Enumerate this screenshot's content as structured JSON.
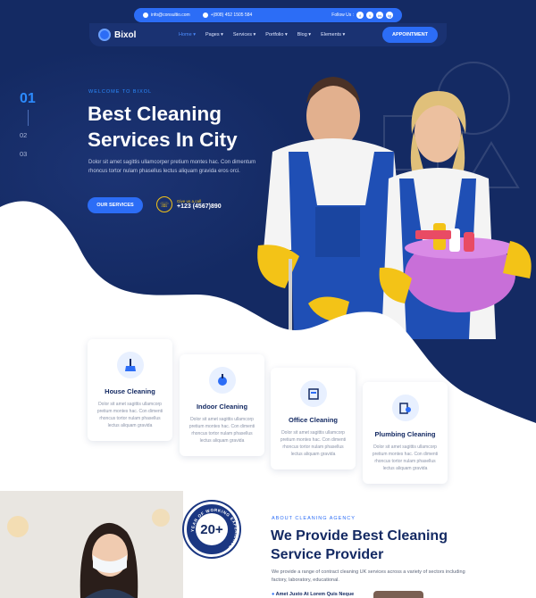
{
  "topbar": {
    "email": "info@consultio.com",
    "phone": "+(808) 452 1505 584",
    "follow_label": "Follow Us :",
    "social": [
      "f",
      "t",
      "in",
      "ig"
    ]
  },
  "nav": {
    "logo": "Bixol",
    "items": [
      "Home",
      "Pages",
      "Services",
      "Portfolio",
      "Blog",
      "Elements"
    ],
    "cta": "APPOINTMENT"
  },
  "hero": {
    "slides": [
      "01",
      "02",
      "03"
    ],
    "eyebrow": "WELCOME TO BIXOL",
    "title_line1": "Best Cleaning",
    "title_line2": "Services In City",
    "lead": "Dolor sit amet sagittis ullamcorper pretium montes hac. Con dimentum rhoncus tortor nulam phasellus lectus aliquam gravida eros orci.",
    "button": "OUR SERVICES",
    "call_label": "Give us a call",
    "call_number": "+123 (4567)890"
  },
  "services": [
    {
      "title": "House Cleaning",
      "desc": "Dolor sit amet sagittis ullamcorp pretium montes hac. Con dimenti rhoncus tortor nulam phasellus lectus aliquam gravida",
      "icon": "broom-icon"
    },
    {
      "title": "Indoor Cleaning",
      "desc": "Dolor sit amet sagittis ullamcorp pretium montes hac. Con dimenti rhoncus tortor nulam phasellus lectus aliquam gravida",
      "icon": "vacuum-icon"
    },
    {
      "title": "Office Cleaning",
      "desc": "Dolor sit amet sagittis ullamcorp pretium montes hac. Con dimenti rhoncus tortor nulam phasellus lectus aliquam gravida",
      "icon": "office-icon"
    },
    {
      "title": "Plumbing Cleaning",
      "desc": "Dolor sit amet sagittis ullamcorp pretium montes hac. Con dimenti rhoncus tortor nulam phasellus lectus aliquam gravida",
      "icon": "plumbing-icon"
    }
  ],
  "about": {
    "badge_ring": "YEAR OF WORKING EXPERIENCE",
    "badge_number": "20+",
    "eyebrow": "ABOUT CLEANING AGENCY",
    "title_line1": "We Provide Best Cleaning",
    "title_line2": "Service Provider",
    "text": "We provide a range of contract cleaning UK services across a variety of sectors including factory, laboratory, educational.",
    "item": "Amet Justo At Lorem Quis Neque"
  },
  "colors": {
    "navy": "#142a63",
    "blue": "#2c6df6",
    "yellow": "#f3c317"
  }
}
